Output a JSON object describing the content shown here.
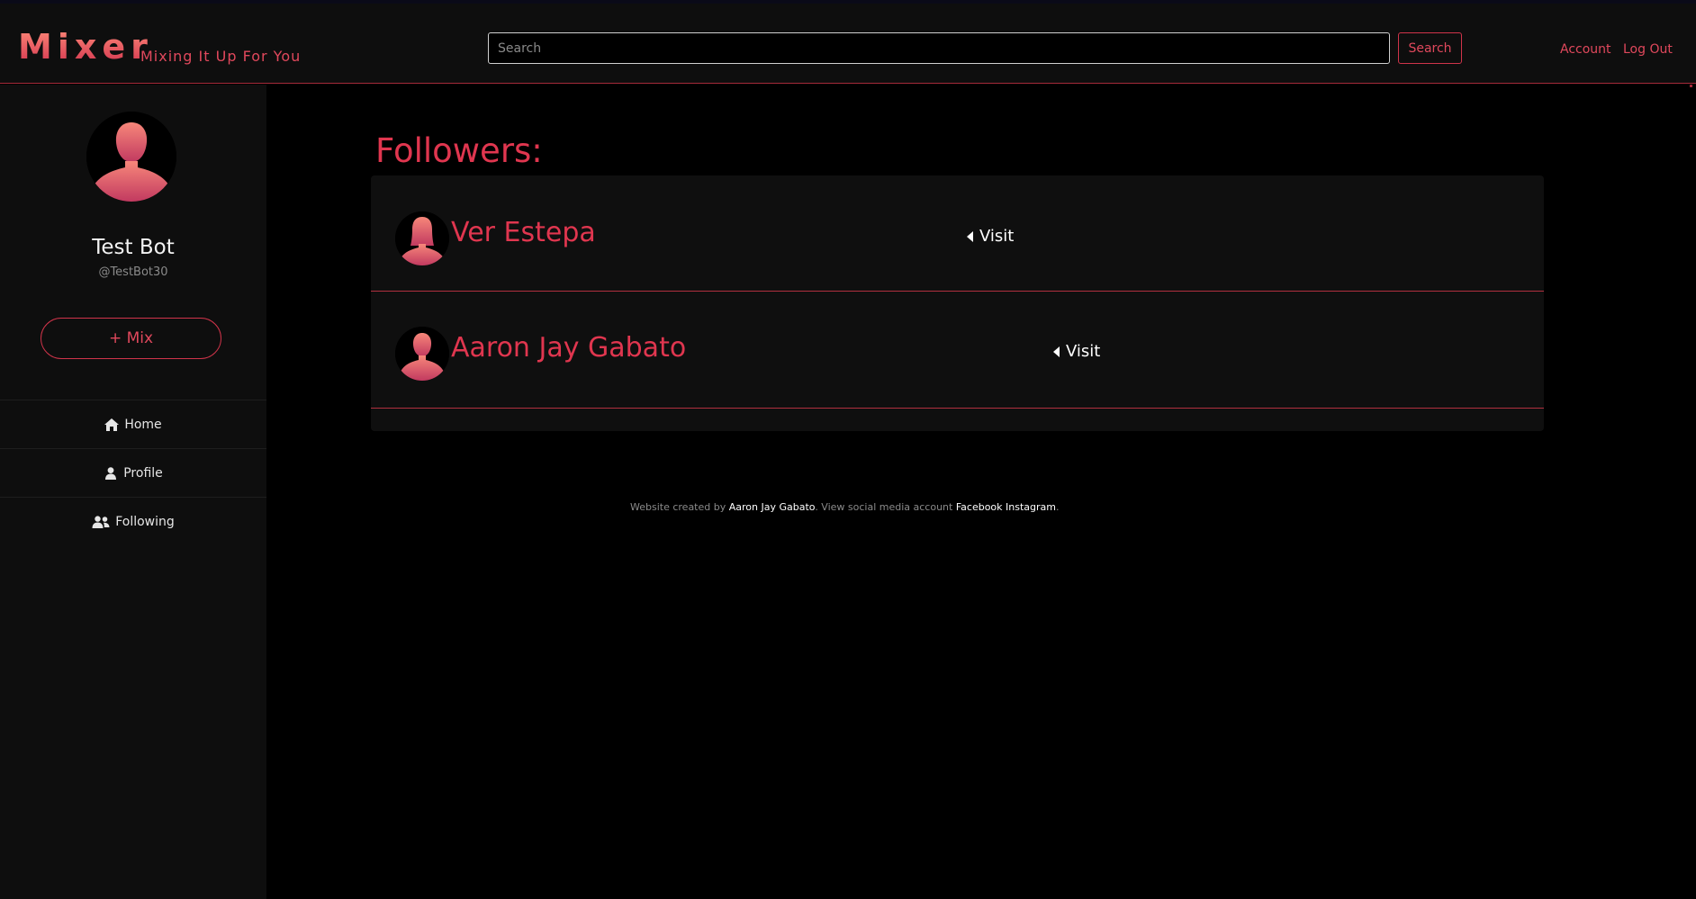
{
  "colors": {
    "accent": "#e0364f",
    "header_bg": "#0e0e0e",
    "sidebar_bg": "#0e0e0e",
    "page_bg": "#000000",
    "card_bg": "#0f0f0f"
  },
  "header": {
    "logo": "Mixer",
    "tagline": "Mixing It Up For You",
    "search_placeholder": "Search",
    "search_button": "Search",
    "nav": {
      "account": "Account",
      "logout": "Log Out"
    }
  },
  "sidebar": {
    "avatar_icon": "user-silhouette-icon",
    "name": "Test Bot",
    "handle": "@TestBot30",
    "mix_button": "+ Mix",
    "items": [
      {
        "label": "Home",
        "icon": "home-icon"
      },
      {
        "label": "Profile",
        "icon": "user-icon"
      },
      {
        "label": "Following",
        "icon": "users-icon"
      }
    ]
  },
  "main": {
    "title": "Followers:",
    "followers": [
      {
        "name": "Ver Estepa",
        "visit_label": "Visit",
        "avatar_icon": "female-silhouette-icon"
      },
      {
        "name": "Aaron Jay Gabato",
        "visit_label": "Visit",
        "avatar_icon": "male-silhouette-icon"
      }
    ]
  },
  "footer": {
    "prefix": "Website created by ",
    "author": "Aaron Jay Gabato",
    "middle": ". View social media account ",
    "facebook": "Facebook",
    "space": " ",
    "instagram": "Instagram",
    "suffix": "."
  }
}
